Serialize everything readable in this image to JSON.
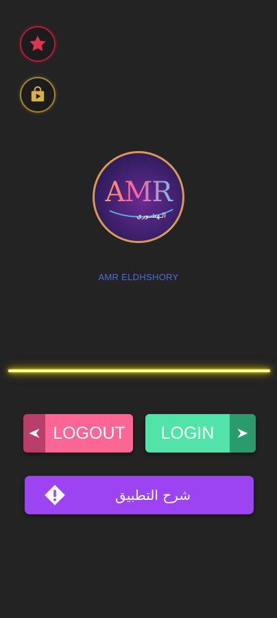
{
  "top_buttons": [
    {
      "icon": "star-icon",
      "color": "#e0334f"
    },
    {
      "icon": "play-store-bag-icon",
      "color": "#d8b04a"
    }
  ],
  "logo": {
    "text": "AMR",
    "subtext": "الـهشـوري"
  },
  "app_name": "AMR ELDHSHORY",
  "buttons": {
    "logout_label": "LOGOUT",
    "login_label": "LOGIN",
    "help_label": "شرح التطبيق"
  },
  "colors": {
    "logout": "#fb6694",
    "login": "#51e3a7",
    "help": "#9c43f2",
    "neon_line": "#f4e21a",
    "app_name": "#4f6be0"
  }
}
